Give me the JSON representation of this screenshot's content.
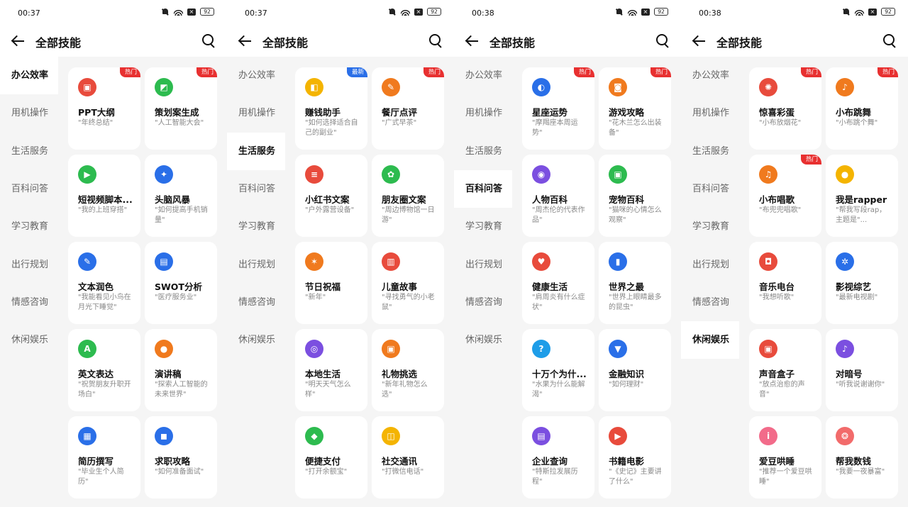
{
  "panels": [
    {
      "time": "00:37",
      "battery": "92",
      "title": "全部技能",
      "active": 0,
      "categories": [
        "办公效率",
        "用机操作",
        "生活服务",
        "百科问答",
        "学习教育",
        "出行规划",
        "情感咨询",
        "休闲娱乐"
      ],
      "cards": [
        {
          "name": "PPT大纲",
          "desc": "\"年终总结\"",
          "color": "#e84b3c",
          "glyph": "▣",
          "badge": "热门"
        },
        {
          "name": "策划案生成",
          "desc": "\"人工智能大会\"",
          "color": "#2dbb4f",
          "glyph": "◩",
          "badge": "热门"
        },
        {
          "name": "短视频脚本...",
          "desc": "\"我的上班穿搭\"",
          "color": "#2dbb4f",
          "glyph": "▶",
          "badge": ""
        },
        {
          "name": "头脑风暴",
          "desc": "\"如何提高手机销量\"",
          "color": "#2a6fe8",
          "glyph": "✦",
          "badge": ""
        },
        {
          "name": "文本润色",
          "desc": "\"我能看见小鸟在月光下睡觉\"",
          "color": "#2a6fe8",
          "glyph": "✎",
          "badge": ""
        },
        {
          "name": "SWOT分析",
          "desc": "\"医疗服务业\"",
          "color": "#2a6fe8",
          "glyph": "▤",
          "badge": ""
        },
        {
          "name": "英文表达",
          "desc": "\"祝贺朋友升职开场白\"",
          "color": "#2dbb4f",
          "glyph": "A",
          "badge": ""
        },
        {
          "name": "演讲稿",
          "desc": "\"探索人工智能的未来世界\"",
          "color": "#f07a1e",
          "glyph": "●",
          "badge": ""
        },
        {
          "name": "简历撰写",
          "desc": "\"毕业生个人简历\"",
          "color": "#2a6fe8",
          "glyph": "▦",
          "badge": ""
        },
        {
          "name": "求职攻略",
          "desc": "\"如何准备面试\"",
          "color": "#2a6fe8",
          "glyph": "◼",
          "badge": ""
        }
      ]
    },
    {
      "time": "00:37",
      "battery": "92",
      "title": "全部技能",
      "active": 2,
      "categories": [
        "办公效率",
        "用机操作",
        "生活服务",
        "百科问答",
        "学习教育",
        "出行规划",
        "情感咨询",
        "休闲娱乐"
      ],
      "cards": [
        {
          "name": "赚钱助手",
          "desc": "\"如何选择适合自己的副业\"",
          "color": "#f4b400",
          "glyph": "◧",
          "badge": "最新"
        },
        {
          "name": "餐厅点评",
          "desc": "\"广式早茶\"",
          "color": "#f07a1e",
          "glyph": "✎",
          "badge": "热门"
        },
        {
          "name": "小红书文案",
          "desc": "\"户外露营设备\"",
          "color": "#e84b3c",
          "glyph": "≡",
          "badge": ""
        },
        {
          "name": "朋友圈文案",
          "desc": "\"周边博物馆一日游\"",
          "color": "#2dbb4f",
          "glyph": "✿",
          "badge": ""
        },
        {
          "name": "节日祝福",
          "desc": "\"新年\"",
          "color": "#f07a1e",
          "glyph": "✶",
          "badge": ""
        },
        {
          "name": "儿童故事",
          "desc": "\"寻找勇气的小老鼠\"",
          "color": "#e84b3c",
          "glyph": "▥",
          "badge": ""
        },
        {
          "name": "本地生活",
          "desc": "\"明天天气怎么样\"",
          "color": "#7b4fe0",
          "glyph": "◎",
          "badge": ""
        },
        {
          "name": "礼物挑选",
          "desc": "\"新年礼物怎么选\"",
          "color": "#f07a1e",
          "glyph": "▣",
          "badge": ""
        },
        {
          "name": "便捷支付",
          "desc": "\"打开余额宝\"",
          "color": "#2dbb4f",
          "glyph": "◆",
          "badge": ""
        },
        {
          "name": "社交通讯",
          "desc": "\"打微信电话\"",
          "color": "#f4b400",
          "glyph": "◫",
          "badge": ""
        }
      ]
    },
    {
      "time": "00:38",
      "battery": "92",
      "title": "全部技能",
      "active": 3,
      "categories": [
        "办公效率",
        "用机操作",
        "生活服务",
        "百科问答",
        "学习教育",
        "出行规划",
        "情感咨询",
        "休闲娱乐"
      ],
      "cards": [
        {
          "name": "星座运势",
          "desc": "\"摩羯座本周运势\"",
          "color": "#2a6fe8",
          "glyph": "◐",
          "badge": "热门"
        },
        {
          "name": "游戏攻略",
          "desc": "\"花木兰怎么出装备\"",
          "color": "#f07a1e",
          "glyph": "◙",
          "badge": "热门"
        },
        {
          "name": "人物百科",
          "desc": "\"周杰伦的代表作品\"",
          "color": "#7b4fe0",
          "glyph": "◉",
          "badge": ""
        },
        {
          "name": "宠物百科",
          "desc": "\"猫咪的心情怎么观察\"",
          "color": "#2dbb4f",
          "glyph": "▣",
          "badge": ""
        },
        {
          "name": "健康生活",
          "desc": "\"肩周炎有什么症状\"",
          "color": "#e84b3c",
          "glyph": "♥",
          "badge": ""
        },
        {
          "name": "世界之最",
          "desc": "\"世界上眼睛最多的昆虫\"",
          "color": "#2a6fe8",
          "glyph": "▮",
          "badge": ""
        },
        {
          "name": "十万个为什...",
          "desc": "\"水果为什么能解渴\"",
          "color": "#1e9de8",
          "glyph": "?",
          "badge": ""
        },
        {
          "name": "金融知识",
          "desc": "\"如何理财\"",
          "color": "#2a6fe8",
          "glyph": "▼",
          "badge": ""
        },
        {
          "name": "企业查询",
          "desc": "\"特斯拉发展历程\"",
          "color": "#7b4fe0",
          "glyph": "▤",
          "badge": ""
        },
        {
          "name": "书籍电影",
          "desc": "\"《史记》主要讲了什么\"",
          "color": "#e84b3c",
          "glyph": "▶",
          "badge": ""
        }
      ]
    },
    {
      "time": "00:38",
      "battery": "92",
      "title": "全部技能",
      "active": 7,
      "categories": [
        "办公效率",
        "用机操作",
        "生活服务",
        "百科问答",
        "学习教育",
        "出行规划",
        "情感咨询",
        "休闲娱乐"
      ],
      "cards": [
        {
          "name": "惊喜彩蛋",
          "desc": "\"小布放烟花\"",
          "color": "#e84b3c",
          "glyph": "✺",
          "badge": "热门"
        },
        {
          "name": "小布跳舞",
          "desc": "\"小布跳个舞\"",
          "color": "#f07a1e",
          "glyph": "♪",
          "badge": "热门"
        },
        {
          "name": "小布唱歌",
          "desc": "\"布兜兜唱歌\"",
          "color": "#f07a1e",
          "glyph": "♫",
          "badge": "热门"
        },
        {
          "name": "我是rapper",
          "desc": "\"帮我写段rap，主题是\"...",
          "color": "#f4b400",
          "glyph": "●",
          "badge": ""
        },
        {
          "name": "音乐电台",
          "desc": "\"我想听歌\"",
          "color": "#e84b3c",
          "glyph": "◘",
          "badge": ""
        },
        {
          "name": "影视综艺",
          "desc": "\"最新电视剧\"",
          "color": "#2a6fe8",
          "glyph": "✲",
          "badge": ""
        },
        {
          "name": "声音盒子",
          "desc": "\"放点治愈的声音\"",
          "color": "#e84b3c",
          "glyph": "▣",
          "badge": ""
        },
        {
          "name": "对暗号",
          "desc": "\"听我说谢谢你\"",
          "color": "#7b4fe0",
          "glyph": "♪",
          "badge": ""
        },
        {
          "name": "爱豆哄睡",
          "desc": "\"推荐一个爱豆哄睡\"",
          "color": "#f26b8a",
          "glyph": "i",
          "badge": ""
        },
        {
          "name": "帮我数钱",
          "desc": "\"我要一夜暴富\"",
          "color": "#f26b6b",
          "glyph": "❂",
          "badge": ""
        }
      ]
    }
  ]
}
